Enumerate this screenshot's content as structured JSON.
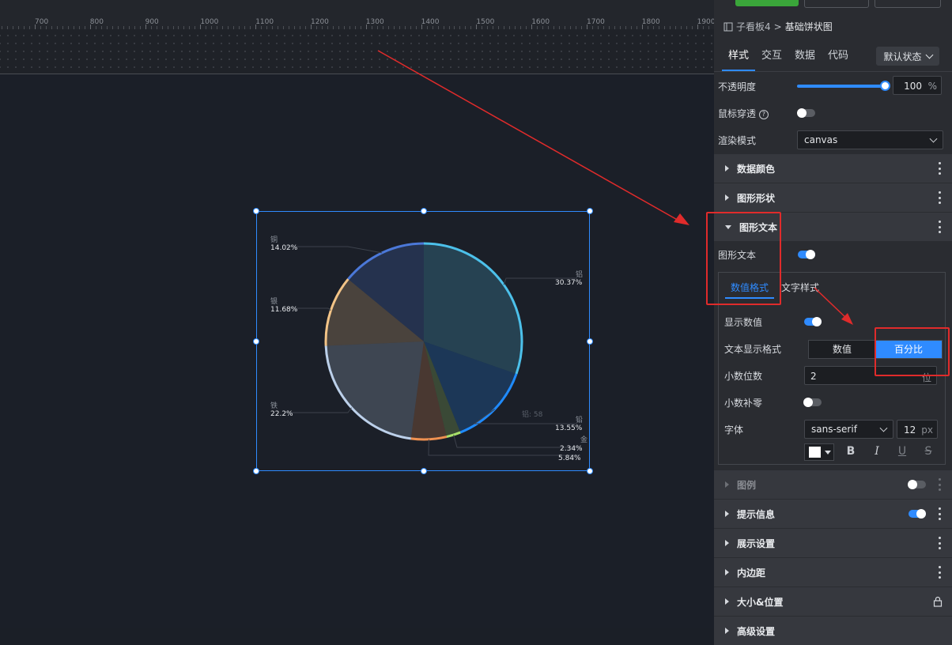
{
  "ruler": {
    "labels": [
      "700",
      "800",
      "900",
      "1000",
      "1100",
      "1200",
      "1300",
      "1400",
      "1500",
      "1600",
      "1700",
      "1800",
      "1900"
    ]
  },
  "chart_data": {
    "type": "pie",
    "title": "",
    "slices": [
      {
        "name": "铝",
        "label": "铝",
        "value_text": "30.37%",
        "value": 30.37,
        "color": "#4cc0ea"
      },
      {
        "name": "铅",
        "label": "铅",
        "value_text": "13.55%",
        "value": 13.55,
        "color": "#1f8bff"
      },
      {
        "name": "金",
        "label": "金",
        "value_text": "2.34%",
        "value": 2.34,
        "color": "#a8e06a"
      },
      {
        "name": "",
        "label": "",
        "value_text": "5.84%",
        "value": 5.84,
        "color": "#ef9151"
      },
      {
        "name": "铁",
        "label": "铁",
        "value_text": "22.2%",
        "value": 22.2,
        "color": "#bcd0ea"
      },
      {
        "name": "银",
        "label": "银",
        "value_text": "11.68%",
        "value": 11.68,
        "color": "#f3c487"
      },
      {
        "name": "铜",
        "label": "铜",
        "value_text": "14.02%",
        "value": 14.02,
        "color": "#4b78d8"
      }
    ],
    "tooltip_text": "铝: 58"
  },
  "panel": {
    "breadcrumb_parent": "子看板4",
    "breadcrumb_sep": ">",
    "breadcrumb_current": "基础饼状图",
    "tabs": [
      "样式",
      "交互",
      "数据",
      "代码"
    ],
    "state_select": "默认状态",
    "opacity": {
      "label": "不透明度",
      "value": "100",
      "unit": "%",
      "level": 1.0
    },
    "mouse_through": {
      "label": "鼠标穿透",
      "help": "?"
    },
    "render_mode": {
      "label": "渲染模式",
      "value": "canvas"
    },
    "sections": {
      "data_color": "数据颜色",
      "shape": "图形形状",
      "text": "图形文本",
      "legend": "图例",
      "tooltip": "提示信息",
      "display": "展示设置",
      "padding": "内边距",
      "size_pos": "大小&位置",
      "bottom": "高级设置"
    },
    "text_toggle_label": "图形文本",
    "subtabs": {
      "value_format": "数值格式",
      "text_style": "文字样式"
    },
    "show_value": "显示数值",
    "format": {
      "label": "文本显示格式",
      "opt_value": "数值",
      "opt_percent": "百分比"
    },
    "decimals": {
      "label": "小数位数",
      "value": "2",
      "unit": "位"
    },
    "pad_zero": "小数补零",
    "font": {
      "label": "字体",
      "family": "sans-serif",
      "size": "12",
      "unit": "px"
    },
    "style_buttons": {
      "bold": "B",
      "italic": "I",
      "underline": "U",
      "strike": "S"
    }
  }
}
